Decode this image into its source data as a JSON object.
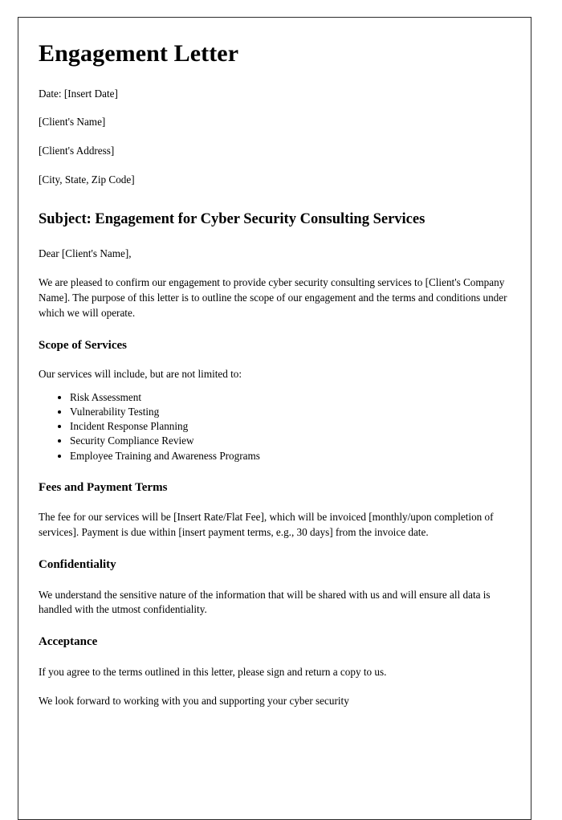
{
  "document": {
    "title": "Engagement Letter",
    "date_line": "Date: [Insert Date]",
    "client_name": "[Client's Name]",
    "client_address": "[Client's Address]",
    "client_city_state_zip": "[City, State, Zip Code]",
    "subject": "Subject: Engagement for Cyber Security Consulting Services",
    "salutation": "Dear [Client's Name],",
    "intro_paragraph": "We are pleased to confirm our engagement to provide cyber security consulting services to [Client's Company Name]. The purpose of this letter is to outline the scope of our engagement and the terms and conditions under which we will operate.",
    "sections": {
      "scope": {
        "heading": "Scope of Services",
        "lead_in": "Our services will include, but are not limited to:",
        "items": [
          "Risk Assessment",
          "Vulnerability Testing",
          "Incident Response Planning",
          "Security Compliance Review",
          "Employee Training and Awareness Programs"
        ]
      },
      "fees": {
        "heading": "Fees and Payment Terms",
        "paragraph": "The fee for our services will be [Insert Rate/Flat Fee], which will be invoiced [monthly/upon completion of services]. Payment is due within [insert payment terms, e.g., 30 days] from the invoice date."
      },
      "confidentiality": {
        "heading": "Confidentiality",
        "paragraph": "We understand the sensitive nature of the information that will be shared with us and will ensure all data is handled with the utmost confidentiality."
      },
      "acceptance": {
        "heading": "Acceptance",
        "paragraph": "If you agree to the terms outlined in this letter, please sign and return a copy to us.",
        "closing_partial": "We look forward to working with you and supporting your cyber security"
      }
    }
  },
  "colors": {
    "text": "#000000",
    "page_border": "#2a2a2a",
    "page_background": "#ffffff"
  }
}
